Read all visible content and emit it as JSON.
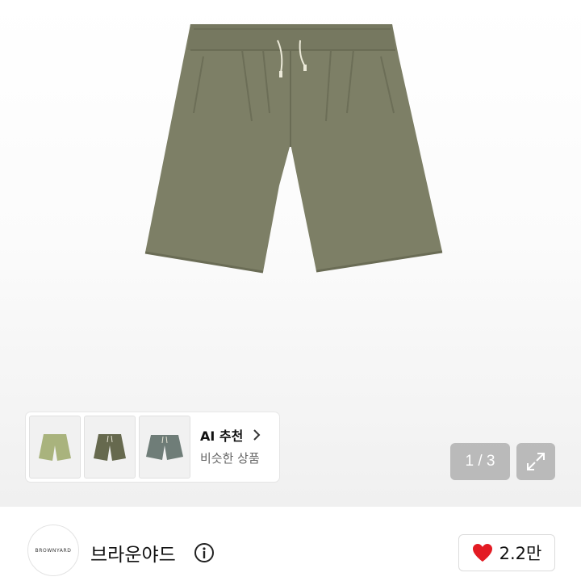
{
  "product": {
    "image_icon": "shorts-photo",
    "main_color": "#7d7f66"
  },
  "recommend": {
    "title": "AI 추천",
    "subtitle": "비슷한 상품",
    "thumbs": [
      {
        "icon": "shorts-thumb",
        "color": "#a9b37d"
      },
      {
        "icon": "shorts-thumb",
        "color": "#66694e"
      },
      {
        "icon": "shorts-thumb",
        "color": "#6f7d78"
      }
    ]
  },
  "gallery": {
    "counter": "1 / 3",
    "expand_icon": "expand-icon"
  },
  "seller": {
    "logo_text": "BROWNYARD",
    "name": "브라운야드",
    "info_icon": "info-icon"
  },
  "like": {
    "icon": "heart-icon",
    "icon_color": "#e31b23",
    "count": "2.2만"
  }
}
